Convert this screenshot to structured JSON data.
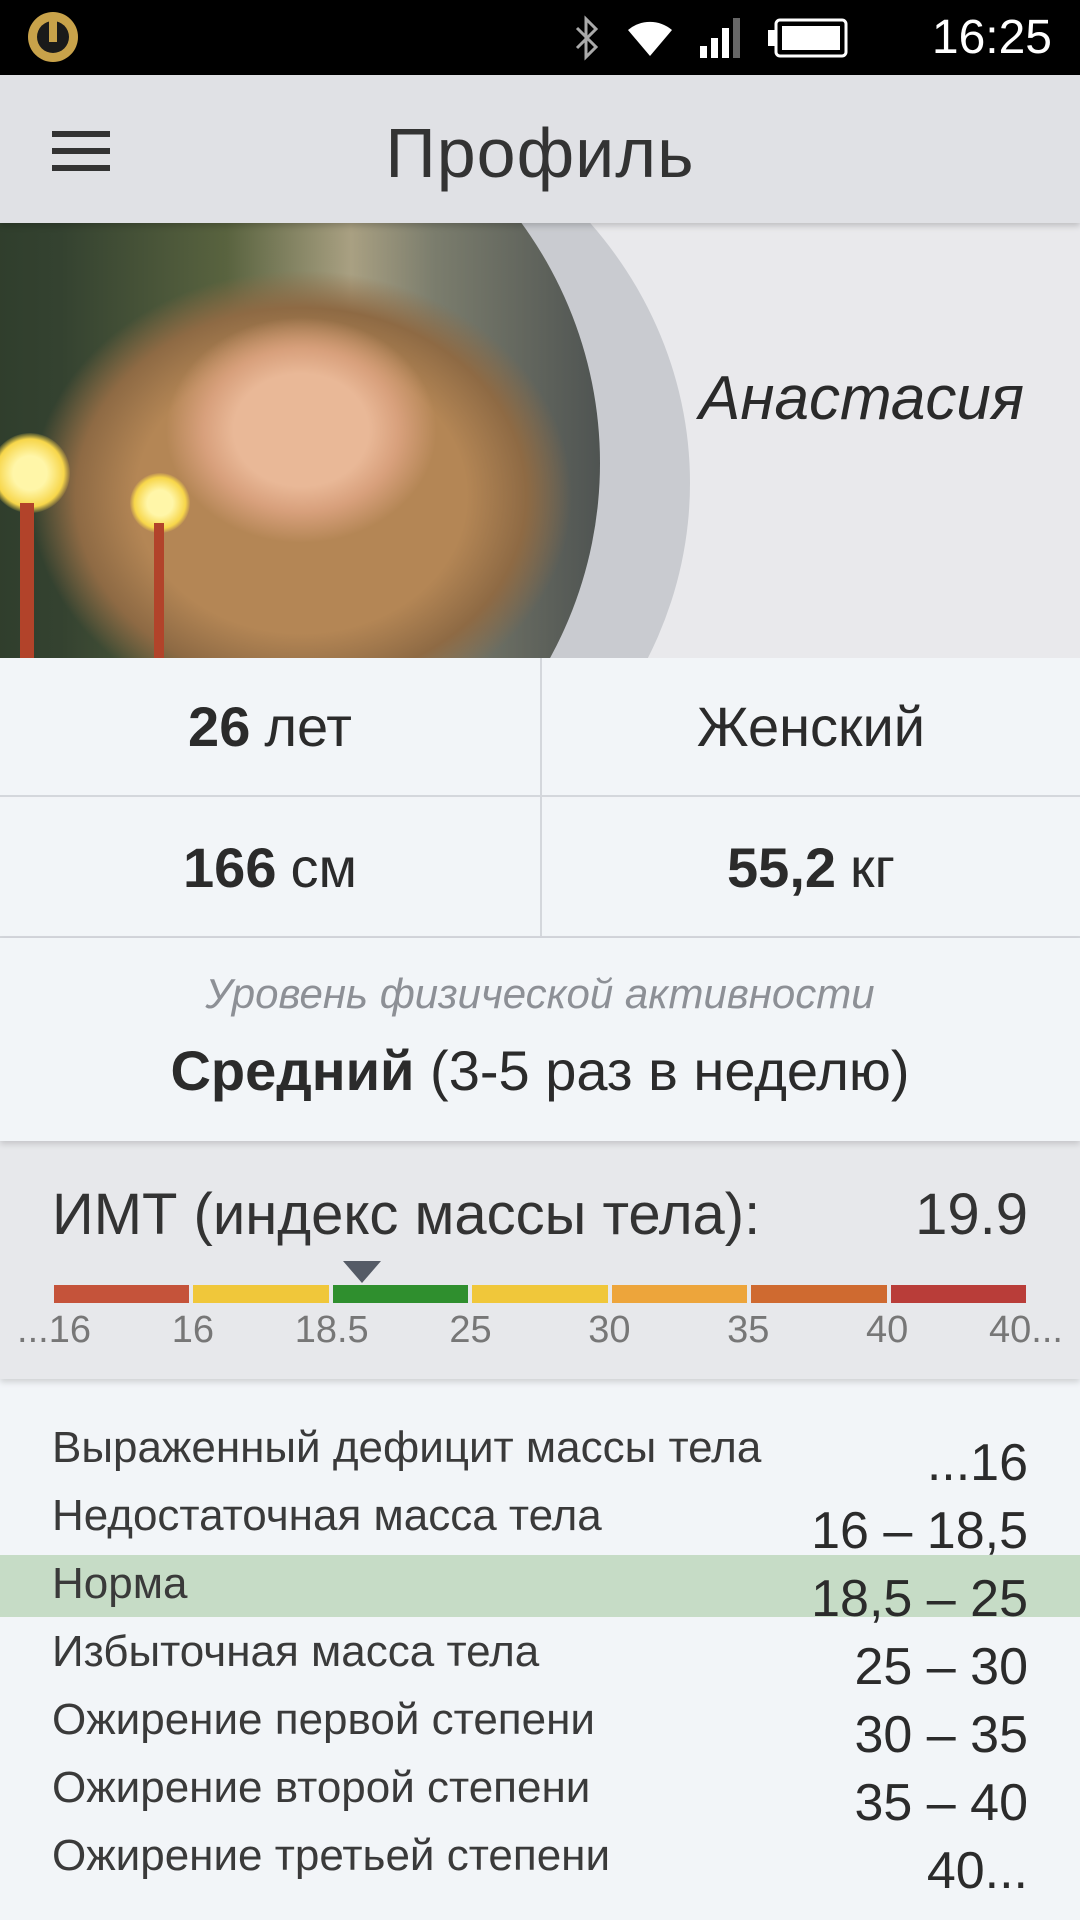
{
  "status_bar": {
    "time": "16:25",
    "icons": [
      "app-logo-icon",
      "bluetooth-icon",
      "wifi-icon",
      "signal-icon",
      "battery-icon"
    ]
  },
  "app_bar": {
    "title": "Профиль",
    "menu_icon": "hamburger-menu-icon"
  },
  "profile": {
    "name": "Анастасия",
    "age_value": "26",
    "age_unit": "лет",
    "gender": "Женский",
    "height_value": "166",
    "height_unit": "см",
    "weight_value": "55,2",
    "weight_unit": "кг"
  },
  "activity": {
    "label": "Уровень физической активности",
    "level": "Средний",
    "detail": "(3-5 раз в неделю)"
  },
  "bmi": {
    "label": "ИМТ (индекс массы тела):",
    "value": "19.9",
    "value_number": 19.9,
    "ticks": [
      "...16",
      "16",
      "18.5",
      "25",
      "30",
      "35",
      "40",
      "40..."
    ],
    "segment_colors": [
      "#c5533a",
      "#f0c73a",
      "#2f8f2e",
      "#f0c73a",
      "#eda53b",
      "#cf6a30",
      "#b93d39"
    ]
  },
  "categories": [
    {
      "name": "Выраженный дефицит массы тела",
      "range": "...16",
      "active": false
    },
    {
      "name": "Недостаточная масса тела",
      "range": "16 – 18,5",
      "active": false
    },
    {
      "name": "Норма",
      "range": "18,5 – 25",
      "active": true
    },
    {
      "name": "Избыточная масса тела",
      "range": "25 – 30",
      "active": false
    },
    {
      "name": "Ожирение первой степени",
      "range": "30 – 35",
      "active": false
    },
    {
      "name": "Ожирение второй степени",
      "range": "35 – 40",
      "active": false
    },
    {
      "name": "Ожирение третьей степени",
      "range": "40...",
      "active": false
    }
  ]
}
